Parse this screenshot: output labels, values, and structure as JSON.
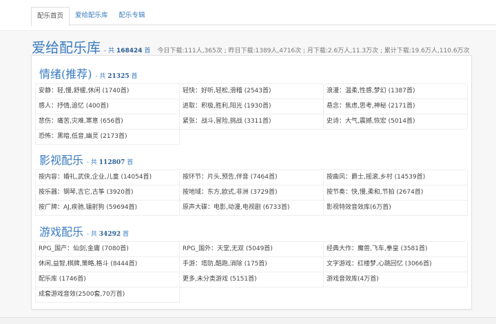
{
  "tabs": [
    "配乐首页",
    "爱给配乐库",
    "配乐专辑"
  ],
  "header": {
    "title": "爱给配乐库",
    "total_prefix": "- 共",
    "total": "168424",
    "total_suffix": "首",
    "stats": "今日下载:111人,365次 ; 昨日下载:1389人,4716次 ; 月下载:2.6万人,11.3万次 ; 累计下载:19.6万人,110.6万次"
  },
  "sections": [
    {
      "title": "情绪(推荐)",
      "total_prefix": "- 共",
      "total": "21325",
      "total_suffix": "首",
      "items": [
        "安静：轻,慢,舒缓,休闲 (1740首)",
        "轻快：好听,轻松,滑稽 (2543首)",
        "浪漫：温柔,性感,梦幻 (1387首)",
        "感人：抒情,追忆 (400首)",
        "进取：积极,胜利,阳光 (1930首)",
        "悬念：焦虑,思考,神秘 (2171首)",
        "悲伤：痛苦,灾难,寒意 (656首)",
        "紧张：战斗,冒险,挑战 (3311首)",
        "史诗：大气,震撼,恢宏 (5014首)",
        "恐怖：黑暗,低音,幽灵 (2173首)"
      ]
    },
    {
      "title": "影视配乐",
      "total_prefix": "- 共",
      "total": "112807",
      "total_suffix": "首",
      "items": [
        "按内容：婚礼,武侠,企业,儿童 (14054首)",
        "按环节：片头,预告,伴音 (7464首)",
        "按曲风：爵士,摇滚,乡村 (14539首)",
        "按乐器：钢琴,吉它,古筝 (3920首)",
        "按地域：东方,欧式,非洲 (3729首)",
        "按节奏：快,慢,柔和,节拍 (2674首)",
        "按厂牌：AJ,疾驰,镭射狗 (59694首)",
        "原声大碟：电影,动漫,电视剧 (6733首)",
        "影视特效音效库(6万首)"
      ]
    },
    {
      "title": "游戏配乐",
      "total_prefix": "- 共",
      "total": "34292",
      "total_suffix": "首",
      "items": [
        "RPG_国产：仙剑,金庸 (7080首)",
        "RPG_国外：天堂,无双 (5049首)",
        "经典大作：魔兽,飞车,拳皇 (3581首)",
        "休闲,益智,棋牌,策略,格斗 (8444首)",
        "手游：塔防,酷跑,消除 (175首)",
        "文字游戏：红楼梦,心跳回忆 (3066首)",
        "配乐库 (1746首)",
        "更多,未分类游戏 (5151首)",
        "游戏音效库(4万首)",
        "成套游戏音效(2500套,70万首)"
      ]
    }
  ]
}
